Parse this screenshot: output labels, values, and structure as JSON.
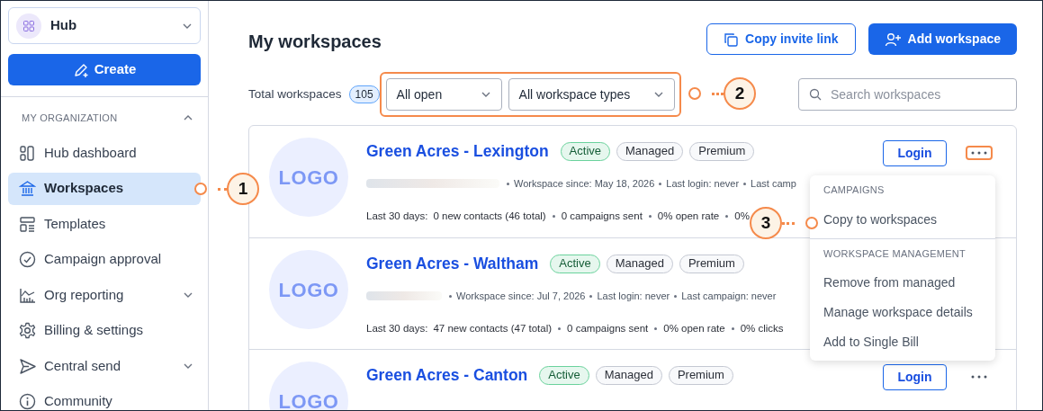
{
  "sidebar": {
    "switcher": {
      "label": "Hub"
    },
    "create_button": "Create",
    "section": {
      "heading": "MY ORGANIZATION",
      "expanded": true
    },
    "items": [
      {
        "label": "Hub dashboard",
        "selected": false,
        "has_submenu": false
      },
      {
        "label": "Workspaces",
        "selected": true,
        "has_submenu": false
      },
      {
        "label": "Templates",
        "selected": false,
        "has_submenu": false
      },
      {
        "label": "Campaign approval",
        "selected": false,
        "has_submenu": false
      },
      {
        "label": "Org reporting",
        "selected": false,
        "has_submenu": true
      },
      {
        "label": "Billing & settings",
        "selected": false,
        "has_submenu": false
      },
      {
        "label": "Central send",
        "selected": false,
        "has_submenu": true
      },
      {
        "label": "Community",
        "selected": false,
        "has_submenu": false
      }
    ]
  },
  "header": {
    "title": "My workspaces",
    "buttons": [
      {
        "label": "Copy invite link",
        "kind": "outline"
      },
      {
        "label": "Add workspace",
        "kind": "primary"
      }
    ]
  },
  "filters": {
    "total_label": "Total workspaces",
    "total_count": "105",
    "dropdowns": [
      "All open",
      "All workspace types"
    ],
    "search": {
      "placeholder": "Search workspaces"
    }
  },
  "workspaces": [
    {
      "logo": "LOGO",
      "name": "Green Acres - Lexington",
      "badges": [
        {
          "label": "Active",
          "kind": "status"
        },
        {
          "label": "Managed",
          "kind": "tag"
        },
        {
          "label": "Premium",
          "kind": "tag"
        }
      ],
      "contact_redacted": true,
      "meta": [
        "Workspace since: May 18, 2026",
        "Last login: never",
        "Last camp"
      ],
      "stats_label": "Last 30 days:",
      "stats": [
        "0 new contacts (46 total)",
        "0 campaigns sent",
        "0% open rate",
        "0%"
      ],
      "login": "Login",
      "menu_open": true
    },
    {
      "logo": "LOGO",
      "name": "Green Acres - Waltham",
      "badges": [
        {
          "label": "Active",
          "kind": "status"
        },
        {
          "label": "Managed",
          "kind": "tag"
        },
        {
          "label": "Premium",
          "kind": "tag"
        }
      ],
      "contact_redacted": true,
      "meta": [
        "Workspace since: Jul 7, 2026",
        "Last login: never",
        "Last campaign: never"
      ],
      "stats_label": "Last 30 days:",
      "stats": [
        "47 new contacts (47 total)",
        "0 campaigns sent",
        "0% open rate",
        "0% clicks"
      ]
    },
    {
      "logo": "LOGO",
      "name": "Green Acres - Canton",
      "badges": [
        {
          "label": "Active",
          "kind": "status"
        },
        {
          "label": "Managed",
          "kind": "tag"
        },
        {
          "label": "Premium",
          "kind": "tag"
        }
      ],
      "login": "Login",
      "menu_open": false
    }
  ],
  "menu": {
    "sections": [
      {
        "heading": "CAMPAIGNS",
        "items": [
          "Copy to workspaces"
        ]
      },
      {
        "heading": "WORKSPACE MANAGEMENT",
        "items": [
          "Remove from managed",
          "Manage workspace details",
          "Add to Single Bill"
        ]
      }
    ]
  },
  "callouts": [
    {
      "number": "1"
    },
    {
      "number": "2"
    },
    {
      "number": "3"
    }
  ]
}
